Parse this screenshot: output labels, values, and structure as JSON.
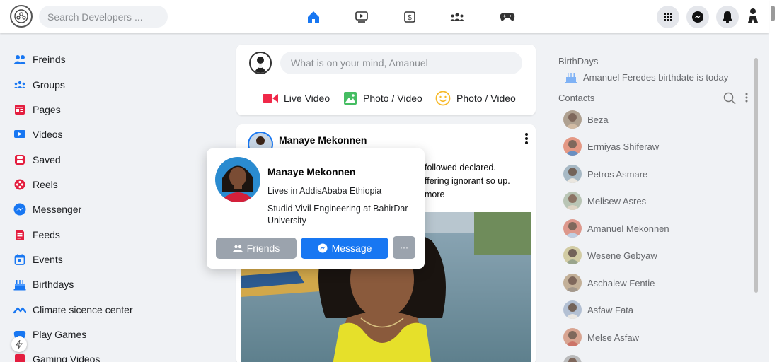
{
  "search": {
    "placeholder": "Search Developers ..."
  },
  "nav": {
    "icons": [
      "home-icon",
      "video-icon",
      "marketplace-icon",
      "groups-icon",
      "gaming-icon"
    ]
  },
  "header_right": {
    "icons": [
      "menu-grid-icon",
      "messenger-icon",
      "bell-icon",
      "profile-icon"
    ]
  },
  "colors": {
    "accent": "#1877f2",
    "muted_button": "#9ba3ad"
  },
  "sidebar": {
    "items": [
      {
        "label": "Freinds",
        "icon": "friends-icon"
      },
      {
        "label": "Groups",
        "icon": "groups-icon"
      },
      {
        "label": "Pages",
        "icon": "pages-icon"
      },
      {
        "label": "Videos",
        "icon": "videos-icon"
      },
      {
        "label": "Saved",
        "icon": "saved-icon"
      },
      {
        "label": "Reels",
        "icon": "reels-icon"
      },
      {
        "label": "Messenger",
        "icon": "messenger-icon"
      },
      {
        "label": "Feeds",
        "icon": "feeds-icon"
      },
      {
        "label": "Events",
        "icon": "events-icon"
      },
      {
        "label": "Birthdays",
        "icon": "birthday-cake-icon"
      },
      {
        "label": "Climate sicence center",
        "icon": "climate-icon"
      },
      {
        "label": "Play Games",
        "icon": "gamepad-icon"
      },
      {
        "label": "Gaming Videos",
        "icon": "gaming-video-icon"
      }
    ]
  },
  "composer": {
    "placeholder": "What is on your mind, Amanuel",
    "actions": [
      {
        "label": "Live Video",
        "icon": "live-video-icon"
      },
      {
        "label": "Photo / Video",
        "icon": "photo-icon"
      },
      {
        "label": "Photo / Video",
        "icon": "feeling-icon"
      }
    ]
  },
  "post": {
    "author": "Manaye Mekonnen",
    "text_lines": [
      "followed declared.",
      "ffering ignorant so up.",
      "more"
    ]
  },
  "hovercard": {
    "name": "Manaye Mekonnen",
    "lives": "Lives in AddisAbaba Ethiopia",
    "studied": "Studid Vivil Engineering at BahirDar University",
    "friends_label": "Friends",
    "message_label": "Message",
    "more_label": "···"
  },
  "rightbar": {
    "birthdays_title": "BirthDays",
    "birthday_text": "Amanuel Feredes birthdate is today",
    "contacts_title": "Contacts",
    "contacts": [
      "Beza",
      "Ermiyas Shiferaw",
      "Petros Asmare",
      "Melisew Asres",
      "Amanuel Mekonnen",
      "Wesene Gebyaw",
      "Aschalew Fentie",
      "Asfaw Fata",
      "Melse Asfaw"
    ]
  }
}
